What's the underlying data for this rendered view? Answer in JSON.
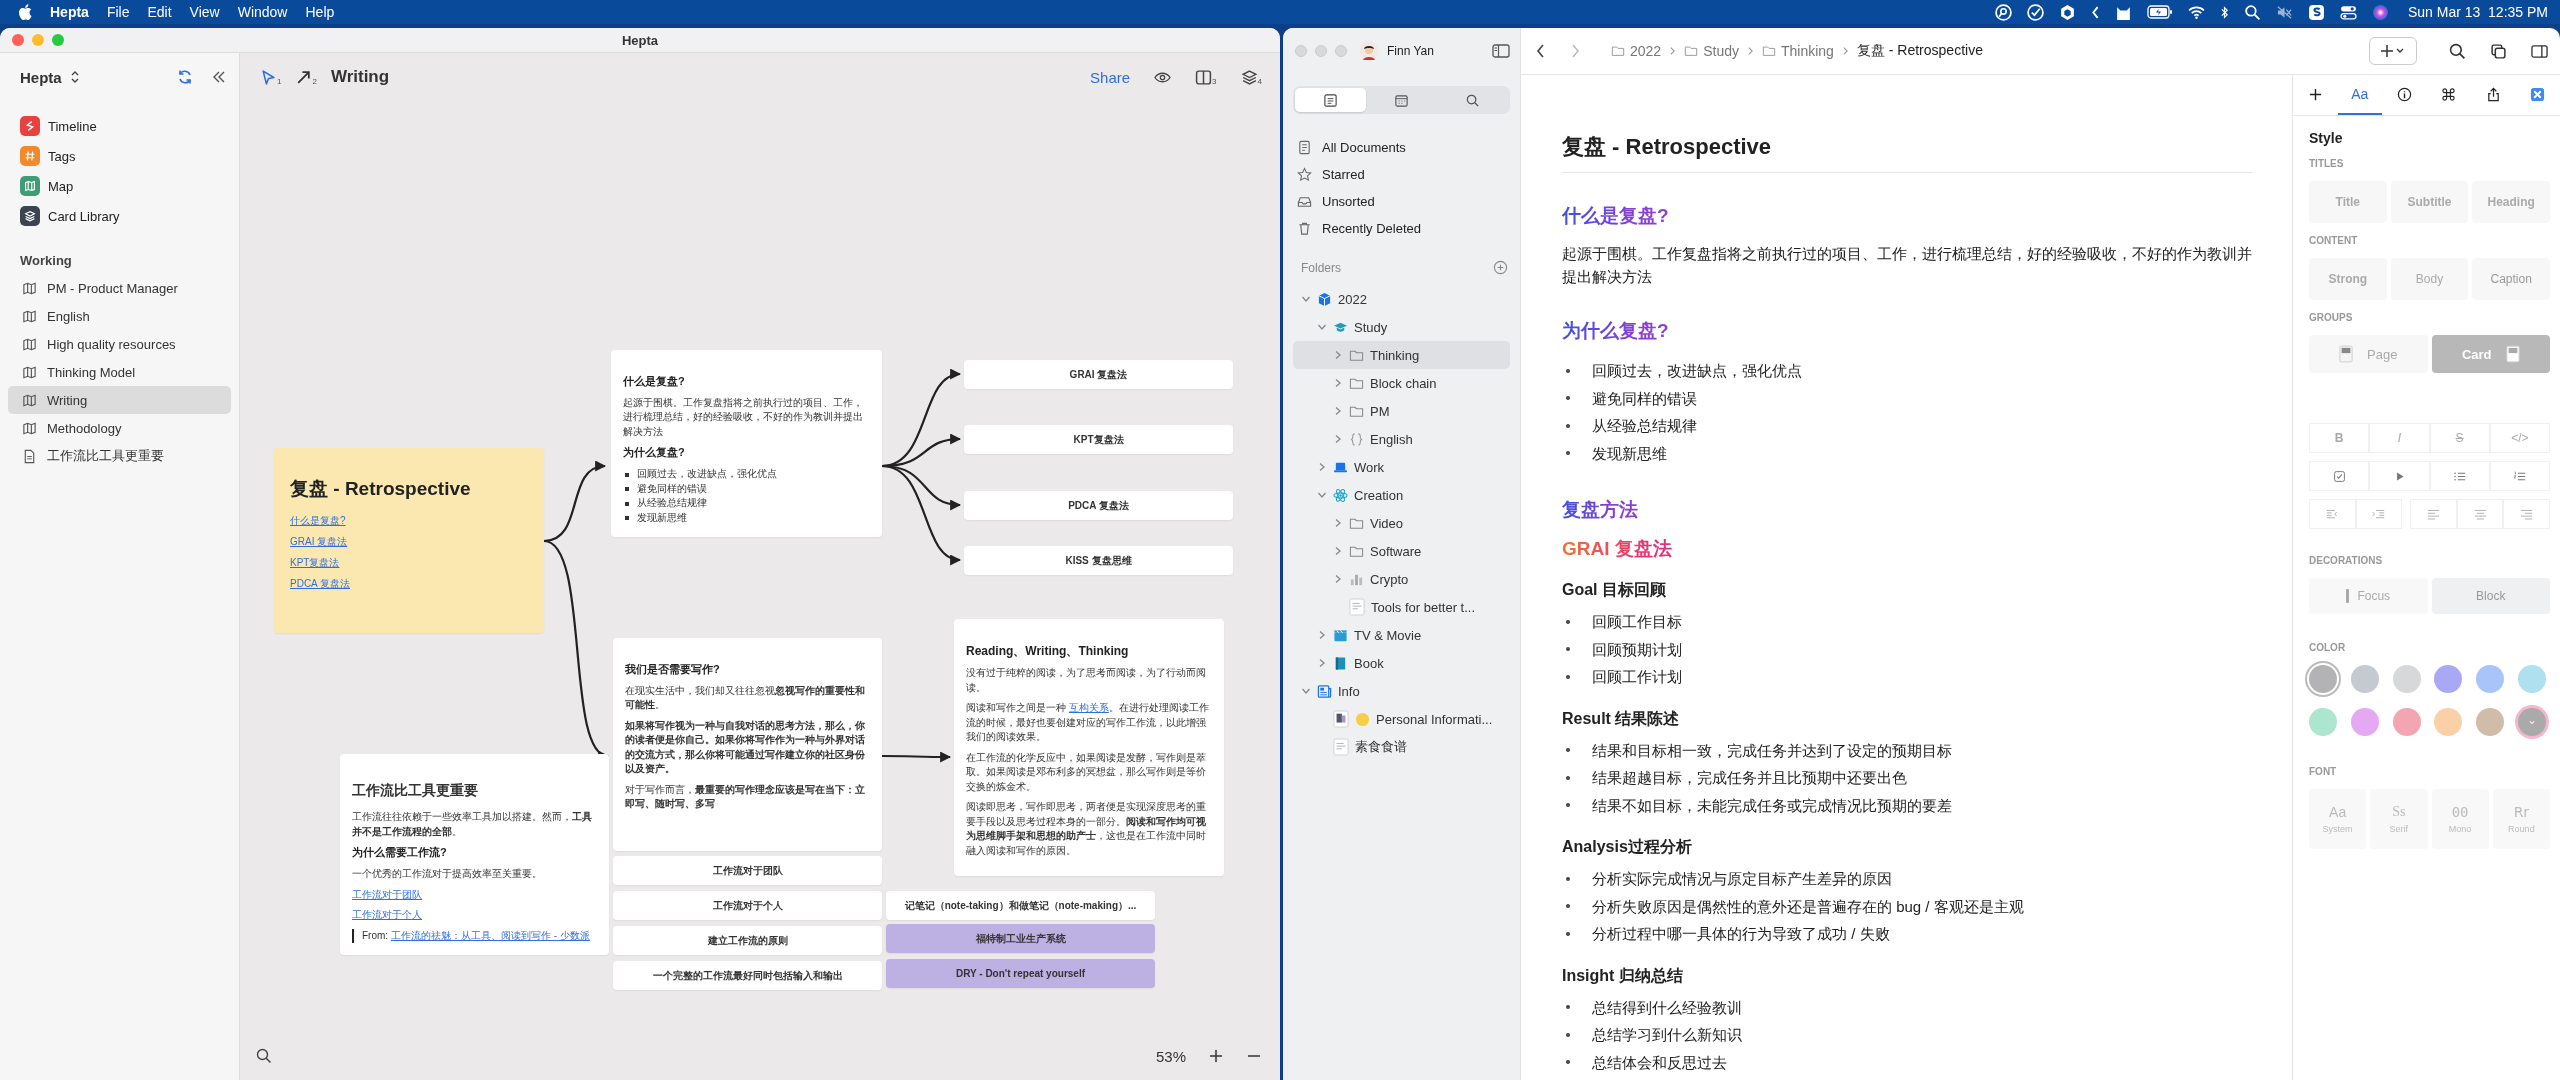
{
  "menu_bar": {
    "app": "Hepta",
    "items": [
      "File",
      "Edit",
      "View",
      "Window",
      "Help"
    ],
    "clock": "Sun Mar 13  12:35 PM"
  },
  "hepta_window": {
    "title": "Hepta",
    "sidebar": {
      "workspace": "Hepta",
      "nav": [
        {
          "label": "Timeline",
          "color": "#e8413f"
        },
        {
          "label": "Tags",
          "color": "#f08a2c"
        },
        {
          "label": "Map",
          "color": "#3f9b78"
        },
        {
          "label": "Card Library",
          "color": "#3c4452"
        }
      ],
      "section": "Working",
      "items": [
        {
          "label": "PM - Product Manager",
          "kind": "map",
          "selected": false
        },
        {
          "label": "English",
          "kind": "map",
          "selected": false
        },
        {
          "label": "High quality resources",
          "kind": "map",
          "selected": false
        },
        {
          "label": "Thinking Model",
          "kind": "map",
          "selected": false
        },
        {
          "label": "Writing",
          "kind": "map",
          "selected": true
        },
        {
          "label": "Methodology",
          "kind": "map",
          "selected": false
        },
        {
          "label": "工作流比工具更重要",
          "kind": "doc",
          "selected": false
        }
      ]
    },
    "toolbar": {
      "tools": [
        {
          "kind": "pointer",
          "shortcut": "1"
        },
        {
          "kind": "arrow",
          "shortcut": "2"
        }
      ],
      "title": "Writing",
      "share": "Share",
      "actions": [
        {
          "kind": "eye"
        },
        {
          "kind": "columns",
          "shortcut": "3"
        },
        {
          "kind": "layers",
          "shortcut": "4"
        }
      ]
    },
    "canvas": {
      "intro_card": {
        "title": "复盘 - Retrospective",
        "links": [
          "什么是复盘?",
          "GRAI 复盘法",
          "KPT复盘法",
          "PDCA 复盘法"
        ]
      },
      "question_card": {
        "heading": "什么是复盘?",
        "text": "起源于围棋。工作复盘指将之前执行过的项目、工作，进行梳理总结，好的经验吸收，不好的作为教训并提出解决方法",
        "subheading": "为什么复盘?",
        "bullets": [
          "回顾过去，改进缺点，强化优点",
          "避免同样的错误",
          "从经验总结规律",
          "发现新思维"
        ]
      },
      "methods": [
        "GRAI 复盘法",
        "KPT复盘法",
        "PDCA 复盘法",
        "KISS 复盘思维"
      ],
      "writing_card": {
        "heading": "我们是否需要写作?",
        "paragraphs": [
          [
            {
              "kind": "text",
              "text": "在现实生活中，我们却又往往忽视**忽视写作的重要性和可能性**。"
            }
          ],
          [
            {
              "kind": "strong",
              "text": "如果将写作视为一种与自我对话的思考方法，那么，你的读者便是你自己。如果你将写作作为一种与外界对话的交流方式，那么你将可能通过写作建立你的社区身份以及资产。"
            }
          ],
          [
            {
              "kind": "text",
              "text": "对于写作而言，**最重要的写作理念应该是写在当下：立即写、随时写、多写**"
            }
          ]
        ]
      },
      "reading_card": {
        "heading": "Reading、Writing、Thinking",
        "paragraphs": [
          [
            {
              "kind": "text",
              "text": "没有过于纯粹的阅读，为了思考而阅读，为了行动而阅读。"
            }
          ],
          [
            {
              "kind": "text",
              "text": "阅读和写作之间是一种 "
            },
            {
              "kind": "link",
              "text": "互构关系"
            },
            {
              "kind": "text",
              "text": "。在进行处理阅读工作流的时候，最好也要创建对应的写作工作流，以此增强我们的阅读效果。"
            }
          ],
          [
            {
              "kind": "text",
              "text": "在工作流的化学反应中，如果阅读是发酵，写作则是萃取。如果阅读是邓布利多的冥想盆，那么写作则是等价交换的炼金术。"
            }
          ],
          [
            {
              "kind": "text",
              "text": "阅读即思考，写作即思考，两者便是实现深度思考的重要手段以及思考过程本身的一部分。**阅读和写作均可视为思维脚手架和思想的助产士**，这也是在工作流中同时融入阅读和写作的原因。"
            }
          ]
        ]
      },
      "workflow_card": {
        "title": "工作流比工具更重要",
        "text": "工作流往往依赖于一些效率工具加以搭建。然而，**工具并不是工作流程的全部**。",
        "heading": "为什么需要工作流?",
        "text_2": "一个优秀的工作流对于提高效率至关重要。",
        "links": [
          "工作流对于团队",
          "工作流对于个人"
        ],
        "source_label": "From:",
        "source_link": "工作流的祛魅：从工具、阅读到写作 - 少数派"
      },
      "topics": [
        {
          "text": "工作流对于团队",
          "kind": "plain"
        },
        {
          "text": "工作流对于个人",
          "kind": "plain"
        },
        {
          "text": "建立工作流的原则",
          "kind": "plain"
        },
        {
          "text": "一个完整的工作流最好同时包括输入和输出",
          "kind": "plain"
        },
        {
          "text": "记笔记（note-taking）和做笔记（note-making）...",
          "kind": "plain"
        },
        {
          "text": "福特制工业生产系统",
          "kind": "highlight"
        },
        {
          "text": "DRY - Don't repeat yourself",
          "kind": "highlight"
        }
      ]
    },
    "zoom": "53%"
  },
  "notes_window": {
    "account": "Finn Yan",
    "views": [
      {
        "kind": "documents",
        "selected": true
      },
      {
        "kind": "calendar",
        "selected": false
      },
      {
        "kind": "search",
        "selected": false
      }
    ],
    "library": [
      {
        "label": "All Documents",
        "kind": "all"
      },
      {
        "label": "Starred",
        "kind": "star"
      },
      {
        "label": "Unsorted",
        "kind": "tray"
      },
      {
        "label": "Recently Deleted",
        "kind": "trash"
      }
    ],
    "folders_label": "Folders",
    "tree": [
      {
        "label": "2022",
        "kind": "cube",
        "expanded": true,
        "selected": false,
        "children": [
          {
            "label": "Study",
            "kind": "cap",
            "expanded": true,
            "selected": false,
            "children": [
              {
                "label": "Thinking",
                "kind": "folder",
                "expanded": false,
                "selected": true
              },
              {
                "label": "Block chain",
                "kind": "folder",
                "expanded": false,
                "selected": false
              },
              {
                "label": "PM",
                "kind": "folder",
                "expanded": false,
                "selected": false
              },
              {
                "label": "English",
                "kind": "braces",
                "expanded": false,
                "selected": false
              }
            ]
          },
          {
            "label": "Work",
            "kind": "laptop",
            "expanded": false,
            "selected": false
          },
          {
            "label": "Creation",
            "kind": "atom",
            "expanded": true,
            "selected": false,
            "children": [
              {
                "label": "Video",
                "kind": "folder",
                "expanded": false,
                "selected": false
              },
              {
                "label": "Software",
                "kind": "folder",
                "expanded": false,
                "selected": false
              },
              {
                "label": "Crypto",
                "kind": "chart",
                "expanded": false,
                "selected": false
              },
              {
                "label": "Tools for better t...",
                "kind": "doc",
                "selected": false
              }
            ]
          },
          {
            "label": "TV & Movie",
            "kind": "clapper",
            "expanded": false,
            "selected": false
          },
          {
            "label": "Book",
            "kind": "book",
            "expanded": false,
            "selected": false
          }
        ]
      },
      {
        "label": "Info",
        "kind": "info",
        "expanded": true,
        "selected": false,
        "children": [
          {
            "label": "Personal Informati...",
            "kind": "emoji-doc",
            "selected": false
          },
          {
            "label": "素食食谱",
            "kind": "doc",
            "selected": false
          }
        ]
      }
    ],
    "breadcrumb": {
      "path": [
        "2022",
        "Study",
        "Thinking"
      ],
      "current": "复盘 - Retrospective"
    },
    "document": {
      "title": "复盘 - Retrospective",
      "blocks": [
        {
          "kind": "h2",
          "text": "什么是复盘?"
        },
        {
          "kind": "p",
          "text": "起源于围棋。工作复盘指将之前执行过的项目、工作，进行梳理总结，好的经验吸收，不好的作为教训并提出解决方法"
        },
        {
          "kind": "h2",
          "text": "为什么复盘?"
        },
        {
          "kind": "list",
          "items": [
            "回顾过去，改进缺点，强化优点",
            "避免同样的错误",
            "从经验总结规律",
            "发现新思维"
          ]
        },
        {
          "kind": "h2",
          "text": "复盘方法"
        },
        {
          "kind": "h3",
          "text": "GRAI 复盘法"
        },
        {
          "kind": "h4",
          "text": "Goal 目标回顾"
        },
        {
          "kind": "list",
          "items": [
            "回顾工作目标",
            "回顾预期计划",
            "回顾工作计划"
          ]
        },
        {
          "kind": "h4",
          "text": "Result 结果陈述"
        },
        {
          "kind": "list",
          "items": [
            "结果和目标相一致，完成任务并达到了设定的预期目标",
            "结果超越目标，完成任务并且比预期中还要出色",
            "结果不如目标，未能完成任务或完成情况比预期的要差"
          ]
        },
        {
          "kind": "h4",
          "text": "Analysis过程分析"
        },
        {
          "kind": "list",
          "items": [
            "分析实际完成情况与原定目标产生差异的原因",
            "分析失败原因是偶然性的意外还是普遍存在的 bug / 客观还是主观",
            "分析过程中哪一具体的行为导致了成功 / 失败"
          ]
        },
        {
          "kind": "h4",
          "text": "Insight 归纳总结"
        },
        {
          "kind": "list",
          "items": [
            "总结得到什么经验教训",
            "总结学习到什么新知识",
            "总结体会和反思过去"
          ]
        }
      ]
    },
    "style_panel": {
      "tabs": [
        {
          "kind": "add",
          "selected": false
        },
        {
          "kind": "style",
          "label": "Aa",
          "selected": true
        },
        {
          "kind": "info",
          "selected": false
        },
        {
          "kind": "command",
          "selected": false
        },
        {
          "kind": "share",
          "selected": false
        },
        {
          "kind": "app",
          "selected": false
        }
      ],
      "heading": "Style",
      "titles": {
        "label": "TITLES",
        "options": [
          "Title",
          "Subtitle",
          "Heading"
        ]
      },
      "content": {
        "label": "CONTENT",
        "options": [
          "Strong",
          "Body",
          "Caption"
        ]
      },
      "groups": {
        "label": "GROUPS",
        "options": [
          {
            "label": "Page",
            "selected": false
          },
          {
            "label": "Card",
            "selected": true
          }
        ]
      },
      "format_rows": [
        {
          "buttons": [
            {
              "kind": "bold",
              "label": "B",
              "disabled": true
            },
            {
              "kind": "italic",
              "label": "I",
              "disabled": true
            },
            {
              "kind": "strike",
              "label": "S",
              "disabled": true
            },
            {
              "kind": "code",
              "label": "</>",
              "disabled": true
            }
          ]
        },
        {
          "buttons": [
            {
              "kind": "checkbox",
              "disabled": false
            },
            {
              "kind": "play",
              "disabled": false
            },
            {
              "kind": "bullets",
              "disabled": false
            },
            {
              "kind": "numbers",
              "disabled": false
            }
          ]
        },
        {
          "buttons": [
            {
              "kind": "outdent",
              "disabled": true
            },
            {
              "kind": "indent",
              "disabled": true
            },
            {
              "kind": "align-left",
              "disabled": true
            },
            {
              "kind": "align-center",
              "disabled": true
            },
            {
              "kind": "align-right",
              "disabled": true
            }
          ]
        }
      ],
      "decorations": {
        "label": "DECORATIONS",
        "options": [
          {
            "label": "Focus",
            "selected": false
          },
          {
            "label": "Block",
            "selected": true
          }
        ]
      },
      "color": {
        "label": "COLOR",
        "swatches": [
          {
            "color": "#b3b3b5",
            "selected": true
          },
          {
            "color": "#c5c9d0",
            "selected": false
          },
          {
            "color": "#d7d8da",
            "selected": false
          },
          {
            "color": "#a9a8f4",
            "selected": false
          },
          {
            "color": "#a8c4f8",
            "selected": false
          },
          {
            "color": "#aee0f0",
            "selected": false
          },
          {
            "color": "#ade6cf",
            "selected": false
          },
          {
            "color": "#e4a9f2",
            "selected": false
          },
          {
            "color": "#f4a6b0",
            "selected": false
          },
          {
            "color": "#fbd0a6",
            "selected": false
          },
          {
            "color": "#d0bca8",
            "selected": false
          }
        ]
      },
      "font": {
        "label": "FONT",
        "options": [
          {
            "sample": "Aa",
            "label": "System"
          },
          {
            "sample": "Ss",
            "label": "Serif"
          },
          {
            "sample": "00",
            "label": "Mono"
          },
          {
            "sample": "Rr",
            "label": "Round"
          }
        ]
      }
    }
  }
}
